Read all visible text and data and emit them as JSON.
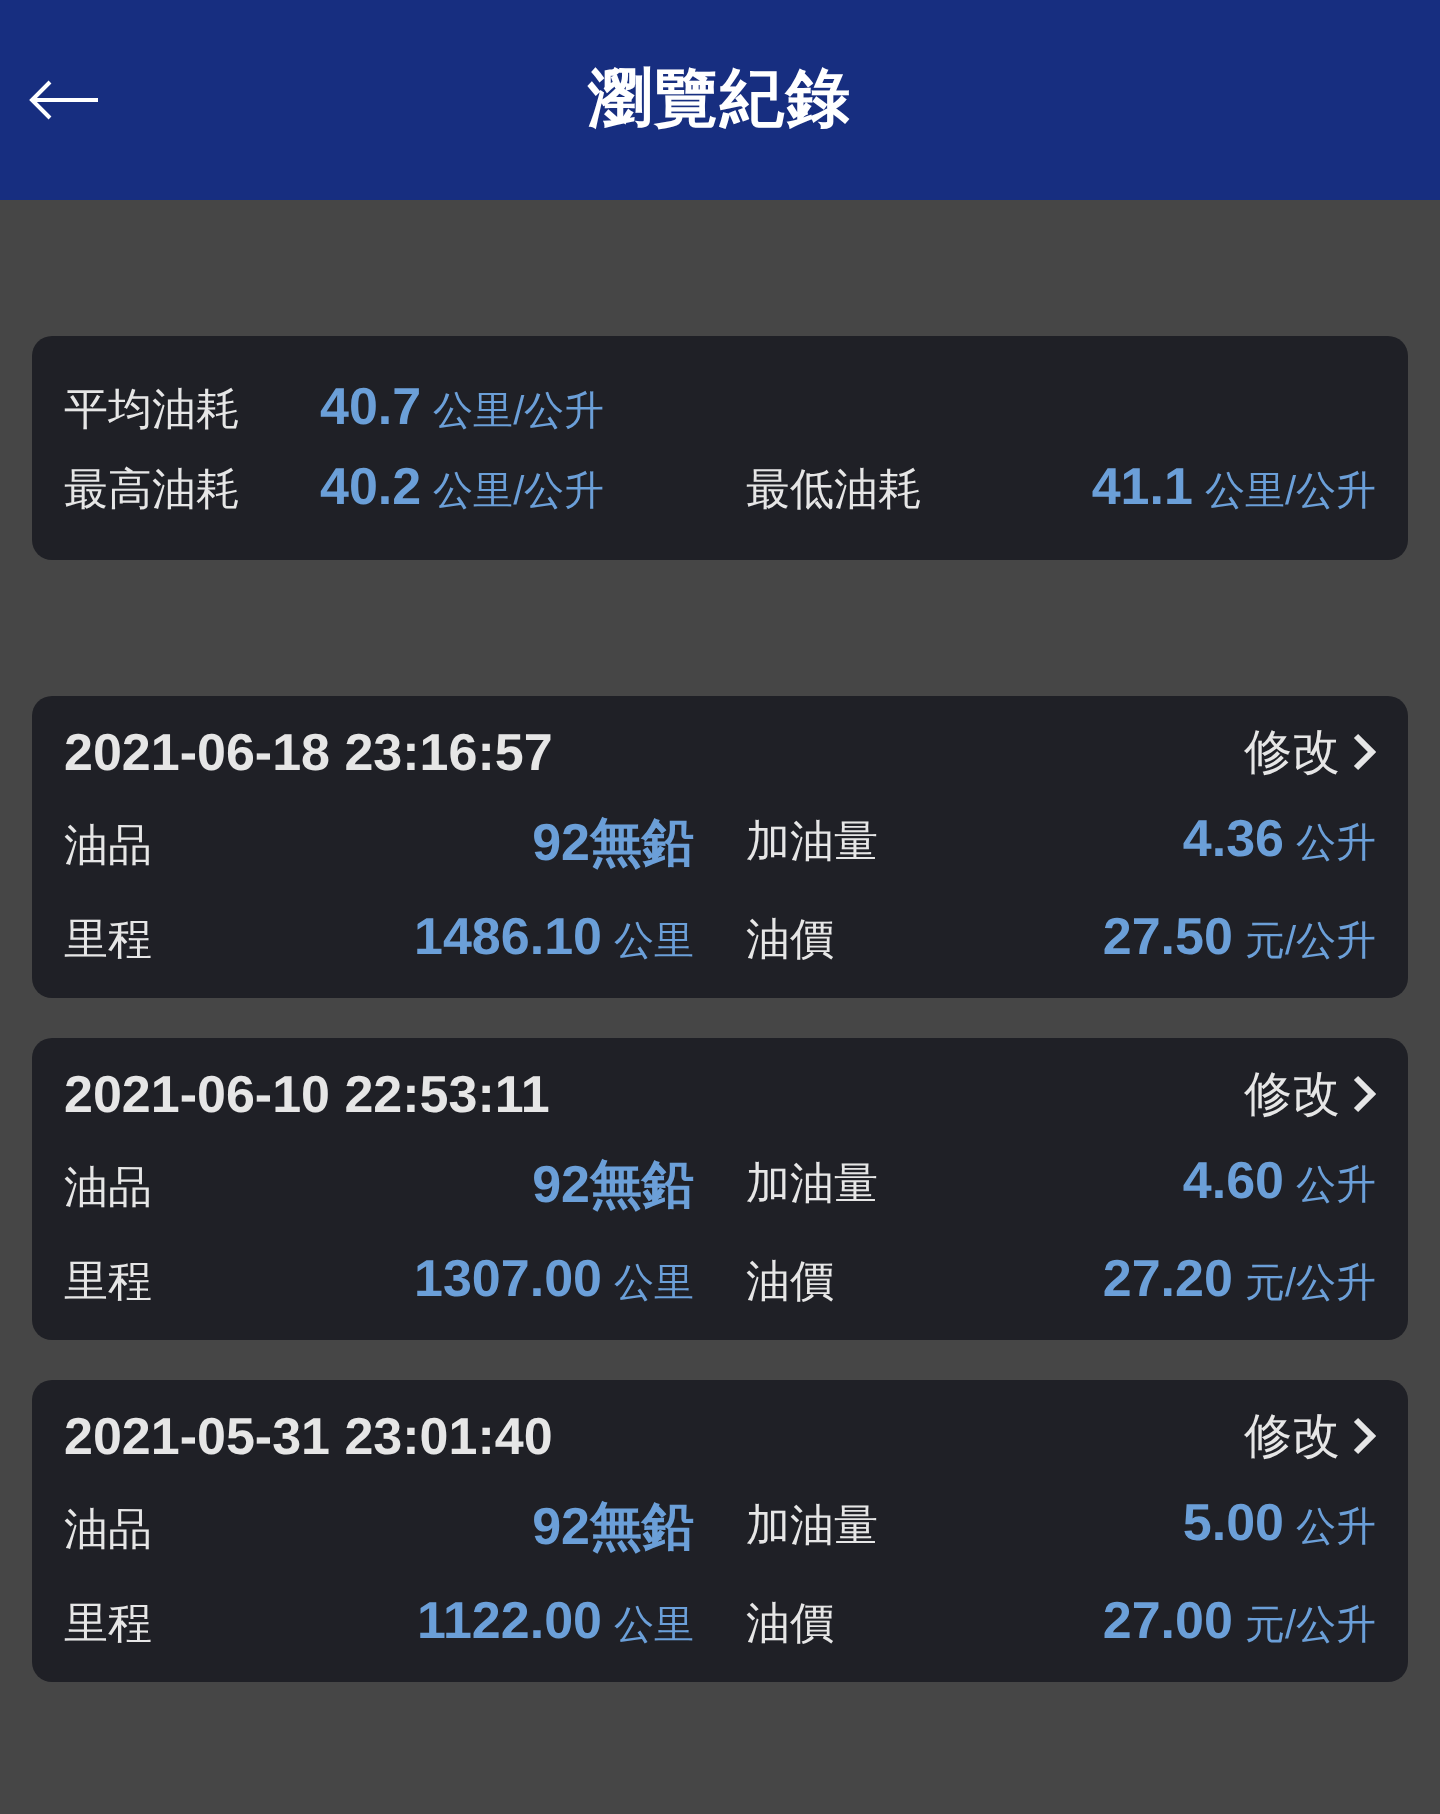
{
  "header": {
    "title": "瀏覽紀錄"
  },
  "summary": [
    {
      "label": "平均油耗",
      "value": "40.7",
      "unit": "公里/公升"
    },
    {
      "label": "最高油耗",
      "value": "40.2",
      "unit": "公里/公升"
    },
    {
      "label": "最低油耗",
      "value": "41.1",
      "unit": "公里/公升"
    }
  ],
  "records": [
    {
      "datetime": "2021-06-18 23:16:57",
      "edit": "修改",
      "fields": [
        {
          "label": "油品",
          "value": "92無鉛"
        },
        {
          "label": "加油量",
          "value": "4.36",
          "unit": "公升"
        },
        {
          "label": "里程",
          "value": "1486.10",
          "unit": "公里"
        },
        {
          "label": "油價",
          "value": "27.50",
          "unit": "元/公升"
        }
      ]
    },
    {
      "datetime": "2021-06-10 22:53:11",
      "edit": "修改",
      "fields": [
        {
          "label": "油品",
          "value": "92無鉛"
        },
        {
          "label": "加油量",
          "value": "4.60",
          "unit": "公升"
        },
        {
          "label": "里程",
          "value": "1307.00",
          "unit": "公里"
        },
        {
          "label": "油價",
          "value": "27.20",
          "unit": "元/公升"
        }
      ]
    },
    {
      "datetime": "2021-05-31 23:01:40",
      "edit": "修改",
      "fields": [
        {
          "label": "油品",
          "value": "92無鉛"
        },
        {
          "label": "加油量",
          "value": "5.00",
          "unit": "公升"
        },
        {
          "label": "里程",
          "value": "1122.00",
          "unit": "公里"
        },
        {
          "label": "油價",
          "value": "27.00",
          "unit": "元/公升"
        }
      ]
    }
  ]
}
